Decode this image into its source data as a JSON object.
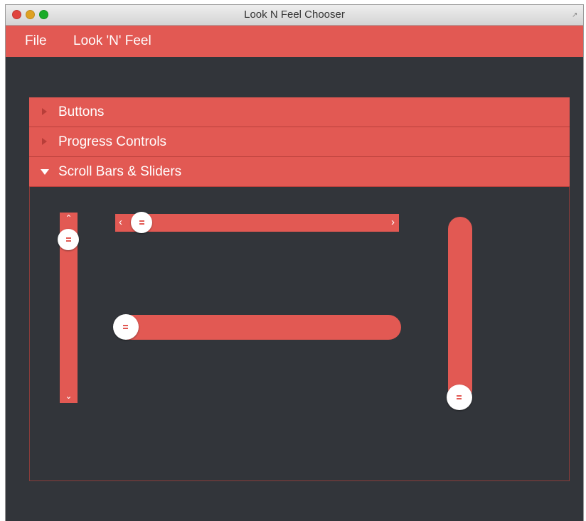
{
  "window": {
    "title": "Look N Feel Chooser"
  },
  "menu": {
    "items": [
      "File",
      "Look 'N' Feel"
    ]
  },
  "accordion": {
    "sections": [
      {
        "label": "Buttons",
        "expanded": false
      },
      {
        "label": "Progress Controls",
        "expanded": false
      },
      {
        "label": "Scroll Bars & Sliders",
        "expanded": true
      }
    ]
  },
  "controls": {
    "vertical_scrollbar": {
      "value_fraction": 0.0,
      "up_icon": "chevron-up-icon",
      "down_icon": "chevron-down-icon"
    },
    "horizontal_scrollbar": {
      "value_fraction": 0.0,
      "left_icon": "chevron-left-icon",
      "right_icon": "chevron-right-icon"
    },
    "horizontal_slider": {
      "value_fraction": 0.0
    },
    "vertical_slider": {
      "value_fraction": 0.0
    }
  },
  "colors": {
    "accent": "#e25953",
    "background": "#32353a",
    "text": "#ffffff"
  }
}
